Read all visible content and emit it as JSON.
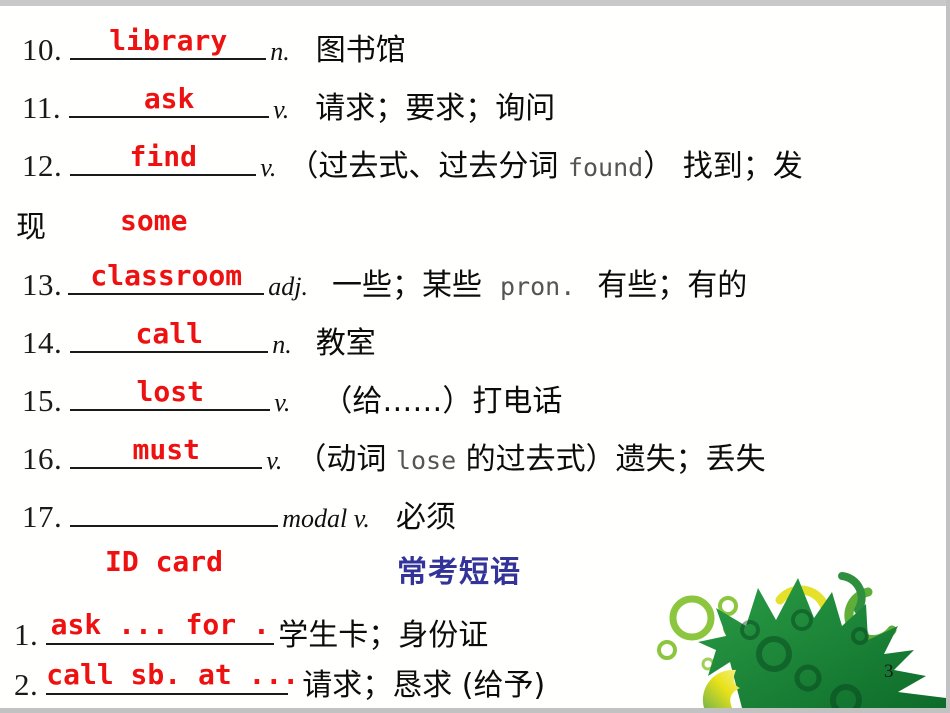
{
  "slide": {
    "page_number": "3",
    "background_color": "#fffffd",
    "accent_red": "#ee1111",
    "accent_blue": "#33339a"
  },
  "vocabulary": [
    {
      "num": "10.",
      "answer": "library",
      "pos": "n.",
      "meaning": "图书馆"
    },
    {
      "num": "11.",
      "answer": "ask",
      "pos": "v.",
      "meaning": "请求；要求；询问"
    },
    {
      "num": "12.",
      "answer": "find",
      "pos": "v.",
      "meaning_pre": "（过去式、过去分词 ",
      "meaning_en": "found",
      "meaning_post": "） 找到；发",
      "meaning_wrap": "现"
    },
    {
      "num": "13.",
      "answer": "classroom",
      "pos": "adj.",
      "meaning": "一些；某些",
      "pos2": "pron.",
      "meaning2": "有些；有的"
    },
    {
      "num": "14.",
      "answer": "call",
      "pos": "n.",
      "meaning": "教室"
    },
    {
      "num": "15.",
      "answer": "lost",
      "pos": "v.",
      "meaning": "（给……）打电话"
    },
    {
      "num": "16.",
      "answer": "must",
      "pos": "v.",
      "meaning_pre": "（动词 ",
      "meaning_en": "lose",
      "meaning_post": " 的过去式）遗失；丢失"
    },
    {
      "num": "17.",
      "answer": "",
      "pos": "modal v.",
      "meaning": "必须"
    }
  ],
  "floating_answers": [
    {
      "text": "some"
    },
    {
      "text": "ID card"
    }
  ],
  "section": {
    "title": "常考短语"
  },
  "phrases": [
    {
      "num": "1.",
      "answer": "ask ... for .",
      "meaning": "学生卡；身份证"
    },
    {
      "num": "2.",
      "answer": "call sb. at ...",
      "meaning": "请求；恳求 (给予)"
    }
  ],
  "decoration": {
    "leaf_icon": "maple-leaf-icon",
    "leaf_color": "#1e8037",
    "bubble_color": "#8cc63e",
    "accent_yellow": "#f2e500"
  }
}
